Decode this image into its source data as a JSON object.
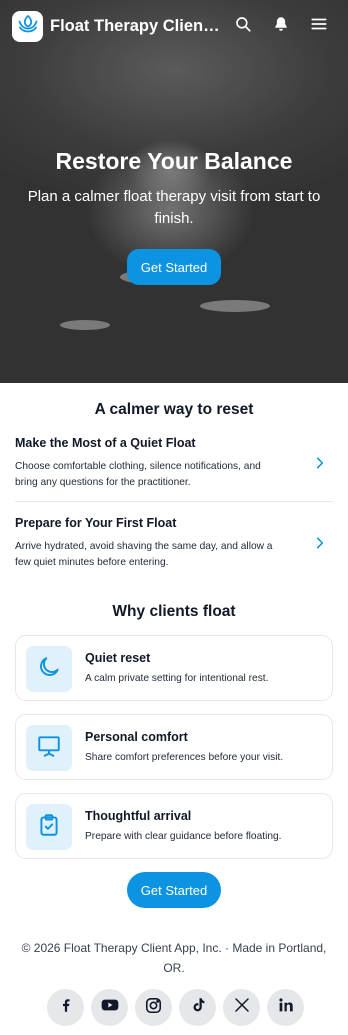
{
  "header": {
    "app_title": "Float Therapy Client App",
    "icons": [
      "waves-logo-icon",
      "search-icon",
      "bell-icon",
      "menu-icon"
    ]
  },
  "hero": {
    "title": "Restore Your Balance",
    "subtitle": "Plan a calmer float therapy visit from start to finish.",
    "cta_label": "Get Started"
  },
  "reset_section": {
    "title": "A calmer way to reset",
    "tips": [
      {
        "title": "Make the Most of a Quiet Float",
        "body": "Choose comfortable clothing, silence notifications, and bring any questions for the practitioner."
      },
      {
        "title": "Prepare for Your First Float",
        "body": "Arrive hydrated, avoid shaving the same day, and allow a few quiet minutes before entering."
      }
    ]
  },
  "why_section": {
    "title": "Why clients float",
    "features": [
      {
        "title": "Quiet reset",
        "body": "A calm private setting for intentional rest.",
        "icon": "moon-icon"
      },
      {
        "title": "Personal comfort",
        "body": "Share comfort preferences before your visit.",
        "icon": "presentation-icon"
      },
      {
        "title": "Thoughtful arrival",
        "body": "Prepare with clear guidance before floating.",
        "icon": "clipboard-check-icon"
      }
    ]
  },
  "cta": {
    "label": "Get Started"
  },
  "footer": {
    "copyright": "© 2026 Float Therapy Client App, Inc. · Made in Portland, OR.",
    "social": [
      "facebook-icon",
      "youtube-icon",
      "instagram-icon",
      "tiktok-icon",
      "x-icon",
      "linkedin-icon"
    ]
  },
  "colors": {
    "accent": "#0c93e2",
    "icon_tint": "#e1f1fb",
    "text": "#111827"
  }
}
